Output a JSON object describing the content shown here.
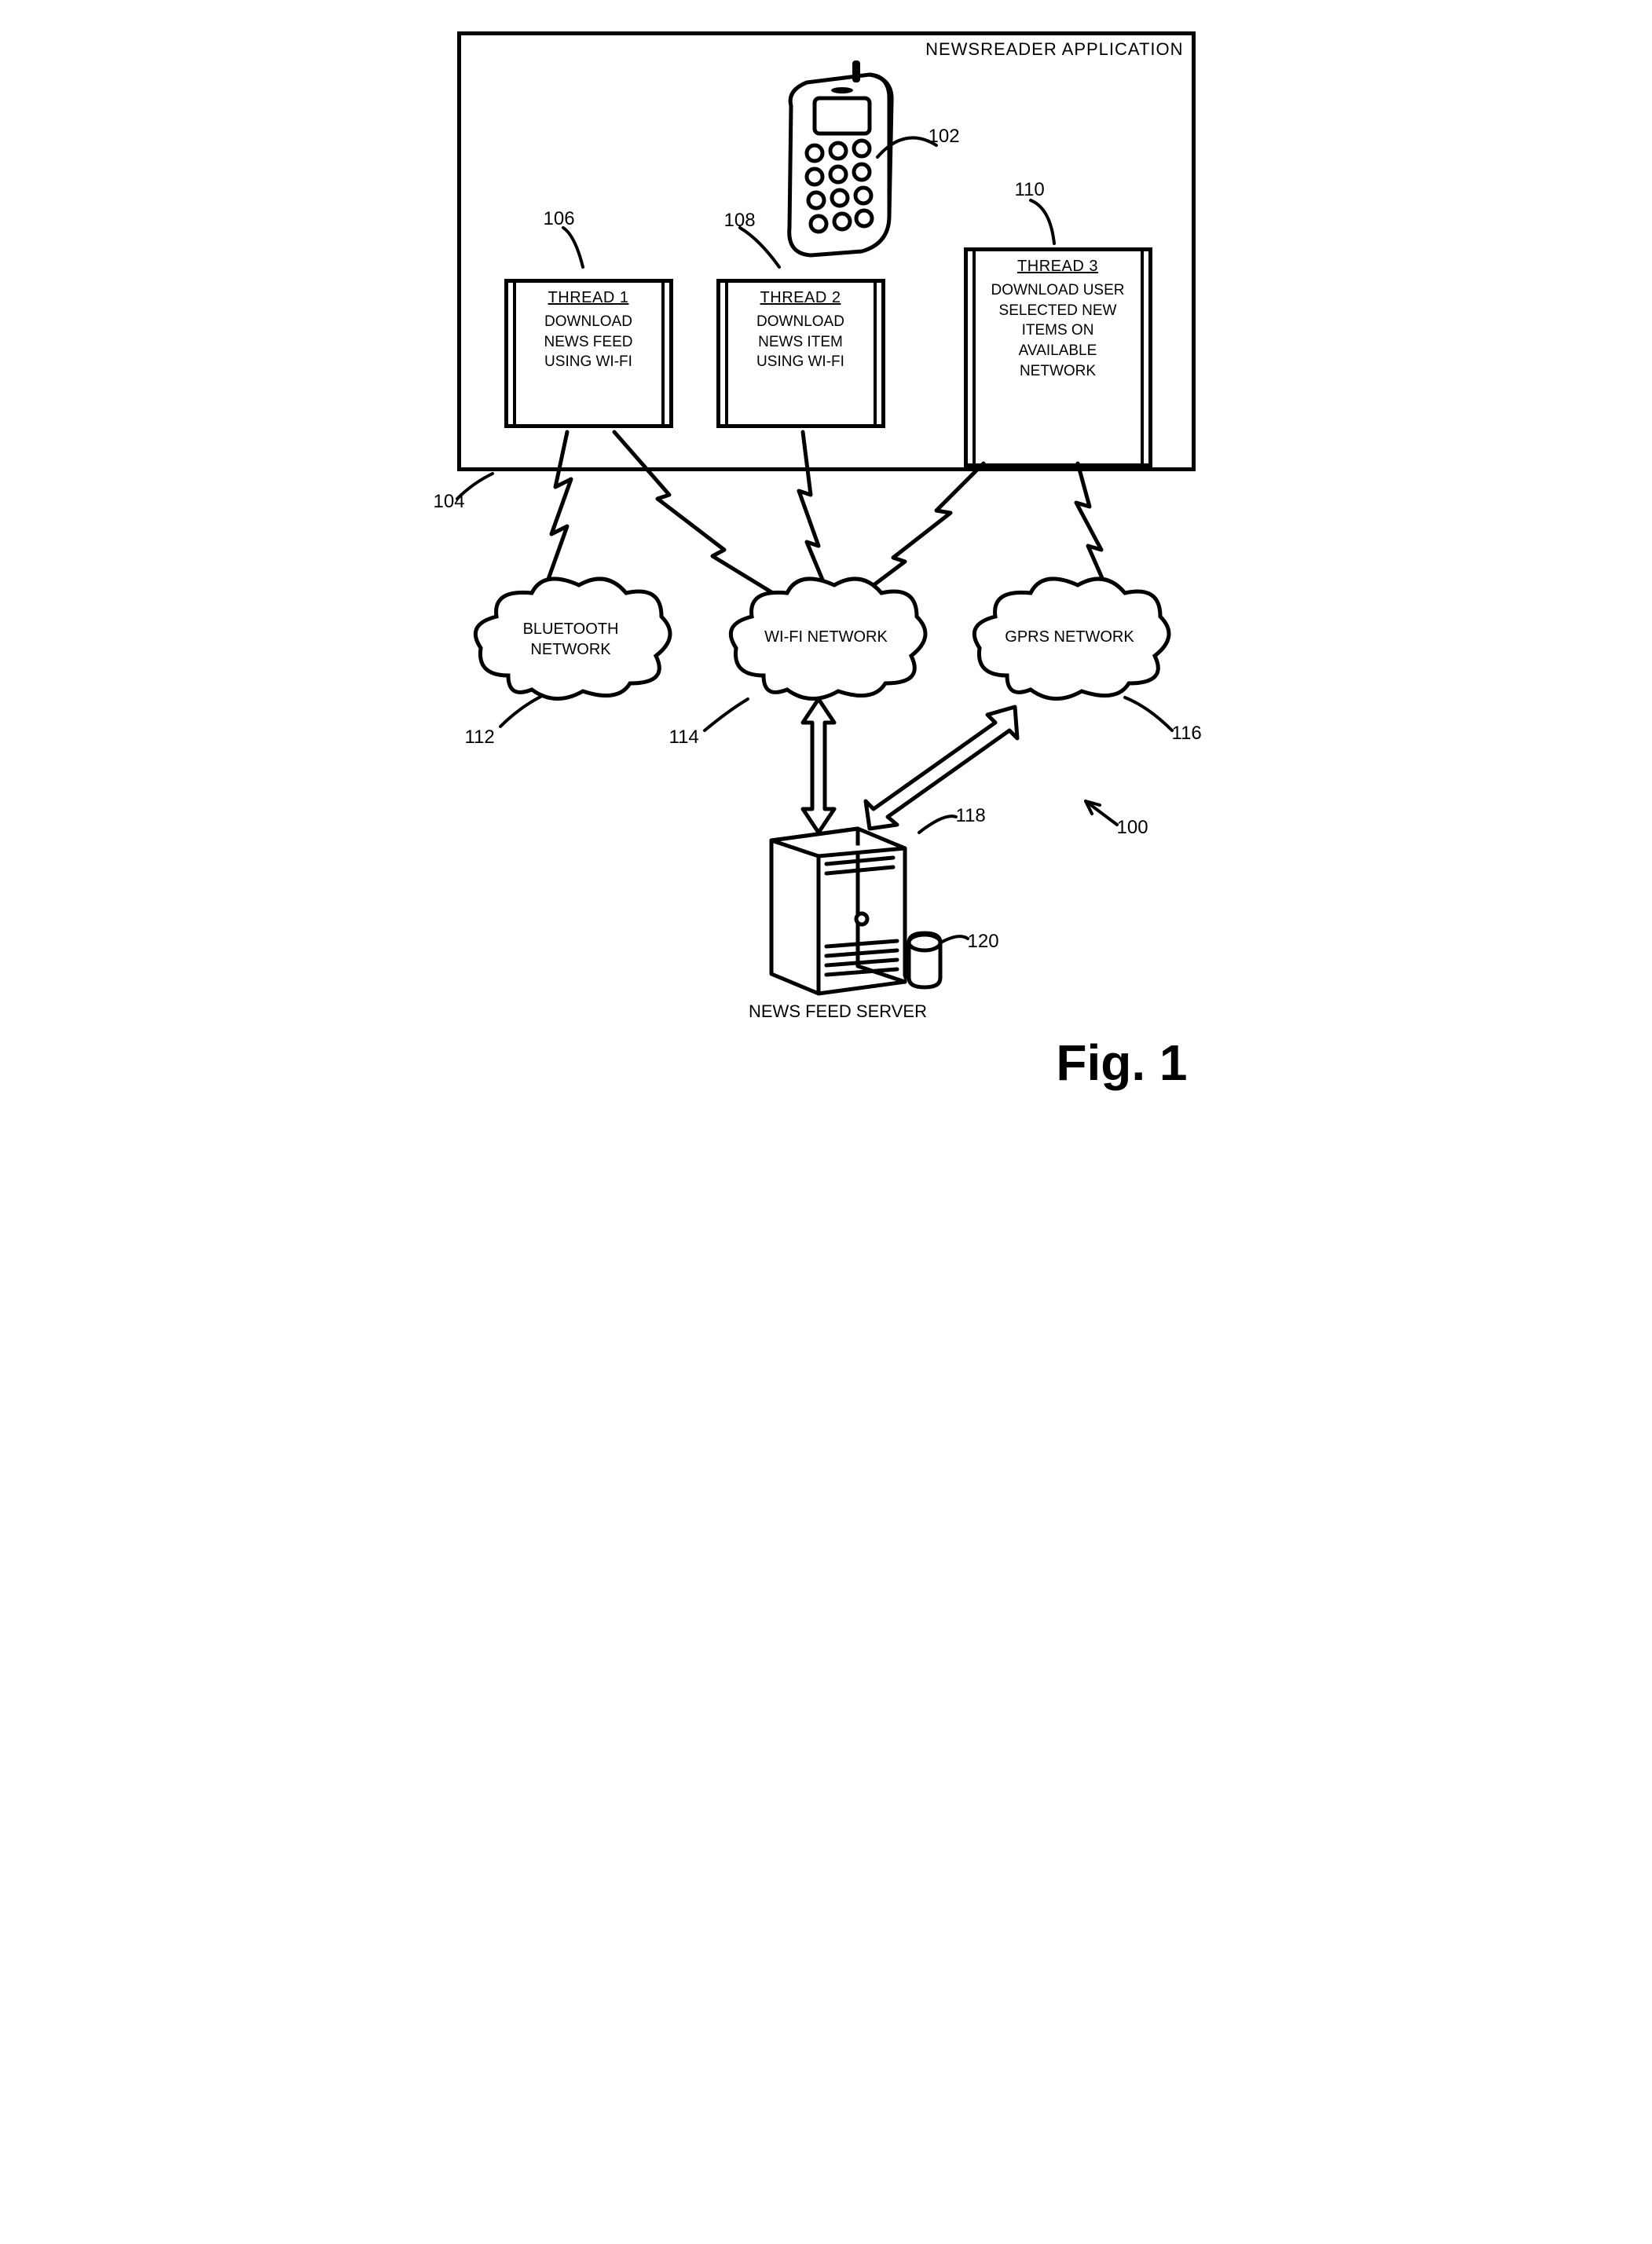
{
  "app": {
    "title": "NEWSREADER APPLICATION"
  },
  "refs": {
    "r100": "100",
    "r102": "102",
    "r104": "104",
    "r106": "106",
    "r108": "108",
    "r110": "110",
    "r112": "112",
    "r114": "114",
    "r116": "116",
    "r118": "118",
    "r120": "120"
  },
  "threads": {
    "t1": {
      "title": "THREAD 1",
      "body": "DOWNLOAD NEWS FEED USING WI-FI"
    },
    "t2": {
      "title": "THREAD 2",
      "body": "DOWNLOAD NEWS ITEM USING WI-FI"
    },
    "t3": {
      "title": "THREAD 3",
      "body": "DOWNLOAD USER SELECTED NEW ITEMS ON AVAILABLE NETWORK"
    }
  },
  "clouds": {
    "bt": "BLUETOOTH NETWORK",
    "wifi": "WI-FI NETWORK",
    "gprs": "GPRS NETWORK"
  },
  "server": {
    "label": "NEWS FEED SERVER"
  },
  "figure": {
    "label": "Fig. 1"
  }
}
